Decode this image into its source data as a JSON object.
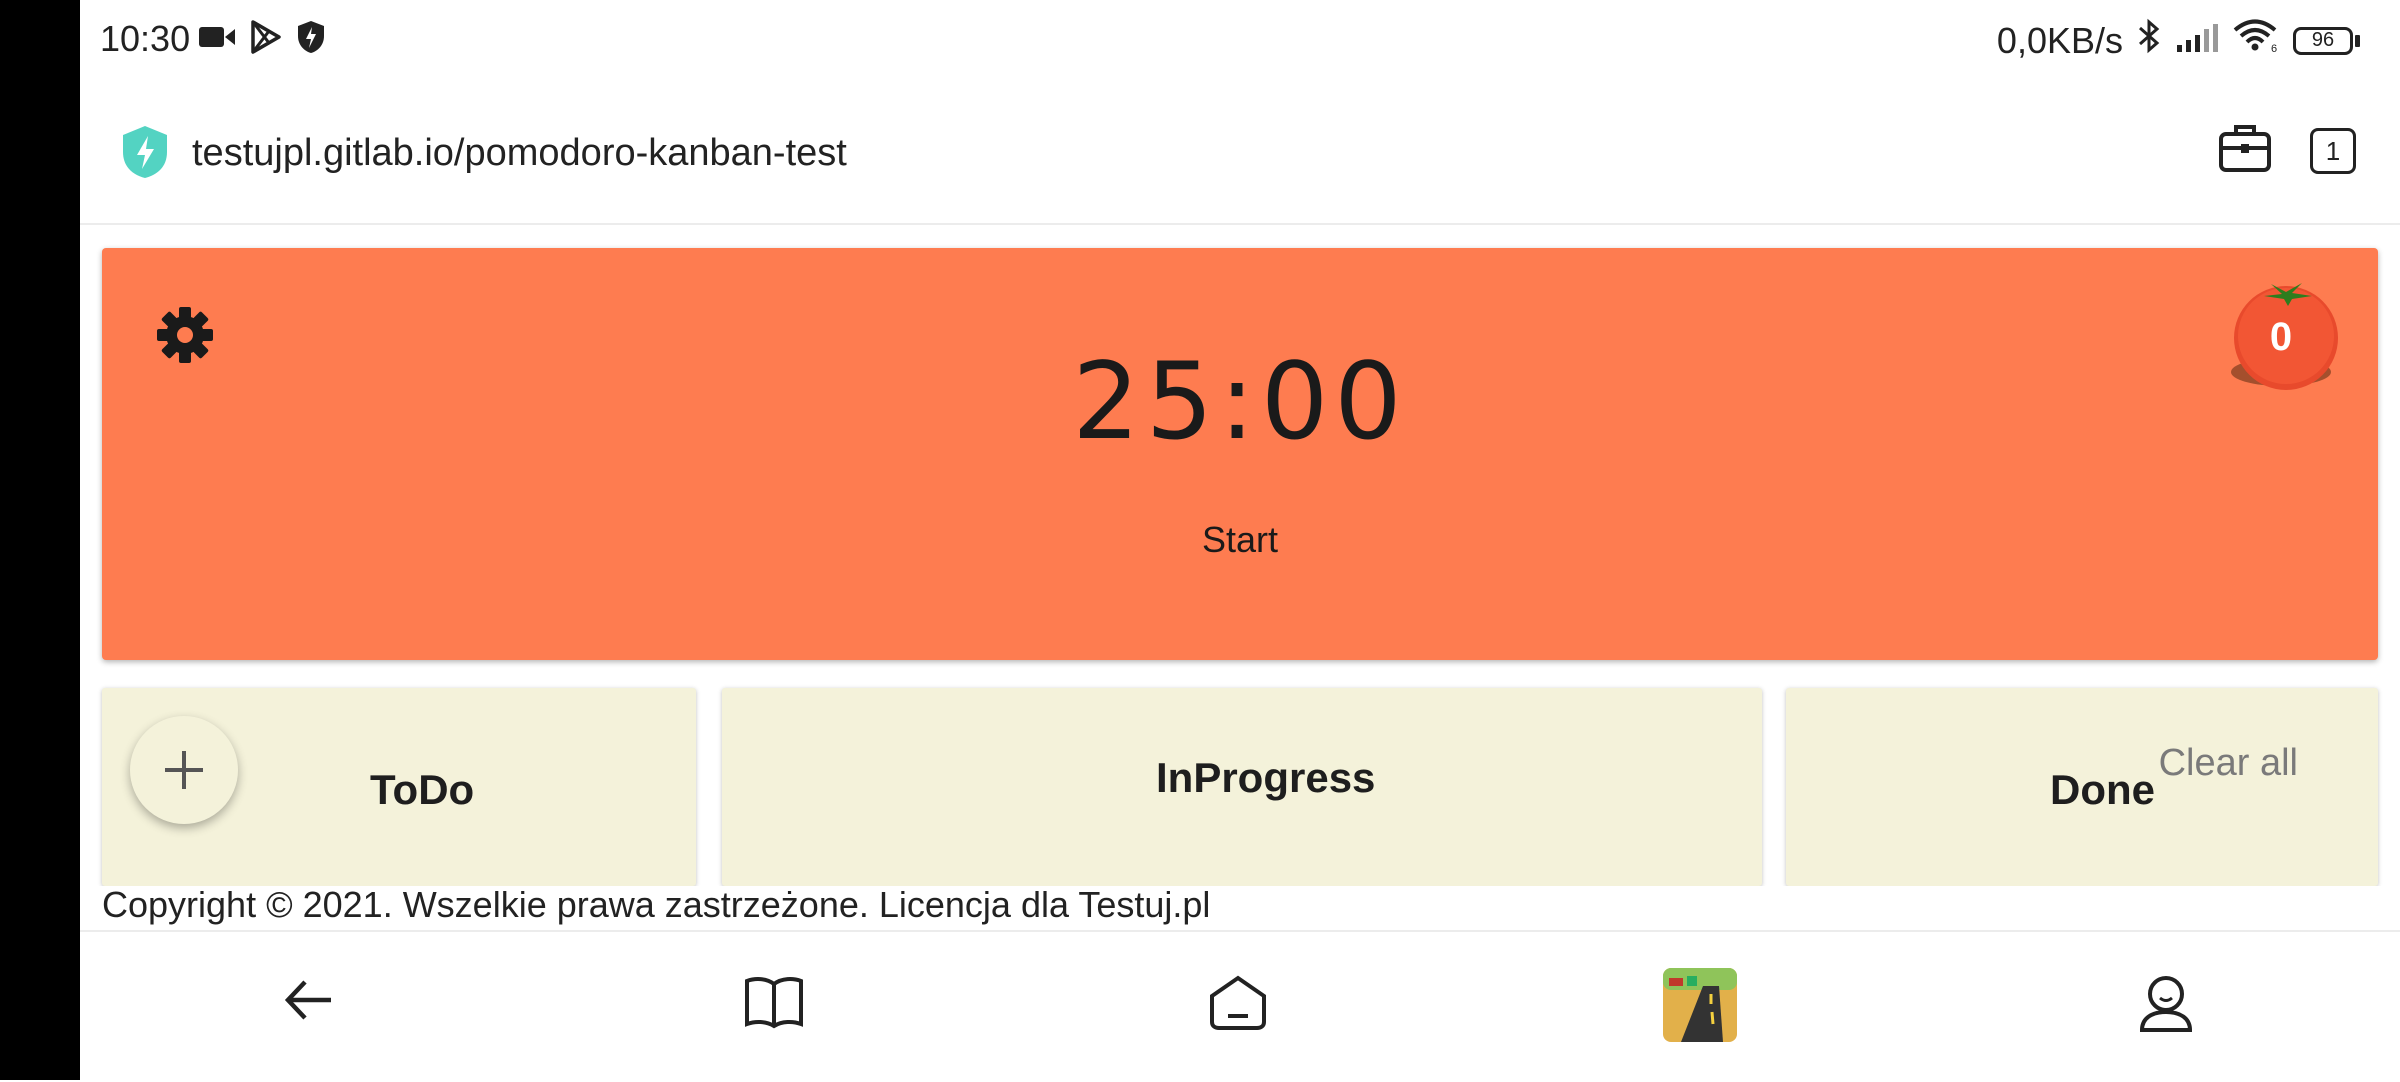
{
  "status_bar": {
    "time": "10:30",
    "network_speed": "0,0KB/s",
    "battery": "96",
    "left_icons": [
      "video-icon",
      "play-store-icon",
      "shield-icon"
    ],
    "right_icons": [
      "bluetooth-icon",
      "signal-icon",
      "wifi-icon",
      "battery-icon"
    ]
  },
  "browser": {
    "url": "testujpl.gitlab.io/pomodoro-kanban-test",
    "tabs_count": "1"
  },
  "timer": {
    "time": "25:00",
    "start_label": "Start",
    "pomodoro_count": "0",
    "bg_color": "#fe7c50"
  },
  "kanban": {
    "columns": [
      {
        "title": "ToDo"
      },
      {
        "title": "InProgress"
      },
      {
        "title": "Done",
        "action": "Clear all"
      }
    ],
    "column_color": "#f4f2da"
  },
  "footer": {
    "copyright": "Copyright © 2021. Wszelkie prawa zastrzeżone. Licencja dla Testuj.pl"
  },
  "bottom_nav": [
    "back-icon",
    "book-icon",
    "home-icon",
    "app-thumbnail-icon",
    "profile-icon"
  ]
}
